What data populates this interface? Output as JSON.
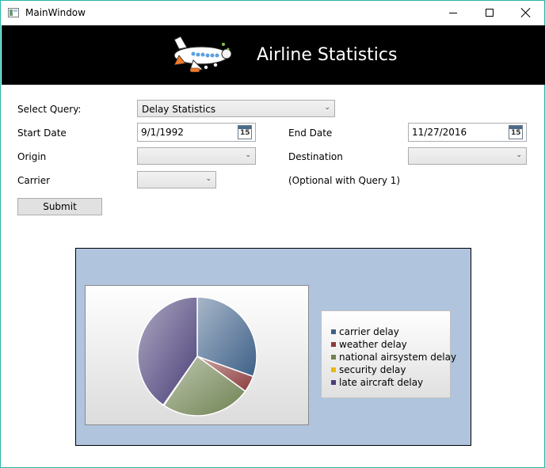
{
  "window": {
    "title": "MainWindow",
    "app_icon": "window-app-icon",
    "controls": {
      "minimize_icon": "minimize-icon",
      "maximize_icon": "maximize-icon",
      "close_icon": "close-icon"
    }
  },
  "banner": {
    "title": "Airline Statistics",
    "image": "airplane-cartoon-image",
    "background": "#000000"
  },
  "form": {
    "select_query": {
      "label": "Select Query:",
      "value": "Delay Statistics"
    },
    "start_date": {
      "label": "Start Date",
      "value": "9/1/1992",
      "icon": "calendar-icon",
      "icon_text": "15"
    },
    "end_date": {
      "label": "End Date",
      "value": "11/27/2016",
      "icon": "calendar-icon",
      "icon_text": "15"
    },
    "origin": {
      "label": "Origin",
      "value": ""
    },
    "destination": {
      "label": "Destination",
      "value": ""
    },
    "carrier": {
      "label": "Carrier",
      "value": "",
      "note": "(Optional with Query 1)"
    },
    "submit_label": "Submit"
  },
  "colors": {
    "chart_background": "#b0c4de",
    "window_border": "#2bb5a6"
  },
  "chart_data": {
    "type": "pie",
    "title": "",
    "categories": [
      "carrier delay",
      "weather delay",
      "national airsystem delay",
      "security delay",
      "late aircraft delay"
    ],
    "values": [
      30.5,
      4.5,
      24.5,
      0.2,
      40.3
    ],
    "colors": [
      "#3e6088",
      "#8c3b3b",
      "#6f8251",
      "#e8b80c",
      "#4a3f78"
    ],
    "start_angle_deg": 0,
    "legend_position": "right"
  }
}
